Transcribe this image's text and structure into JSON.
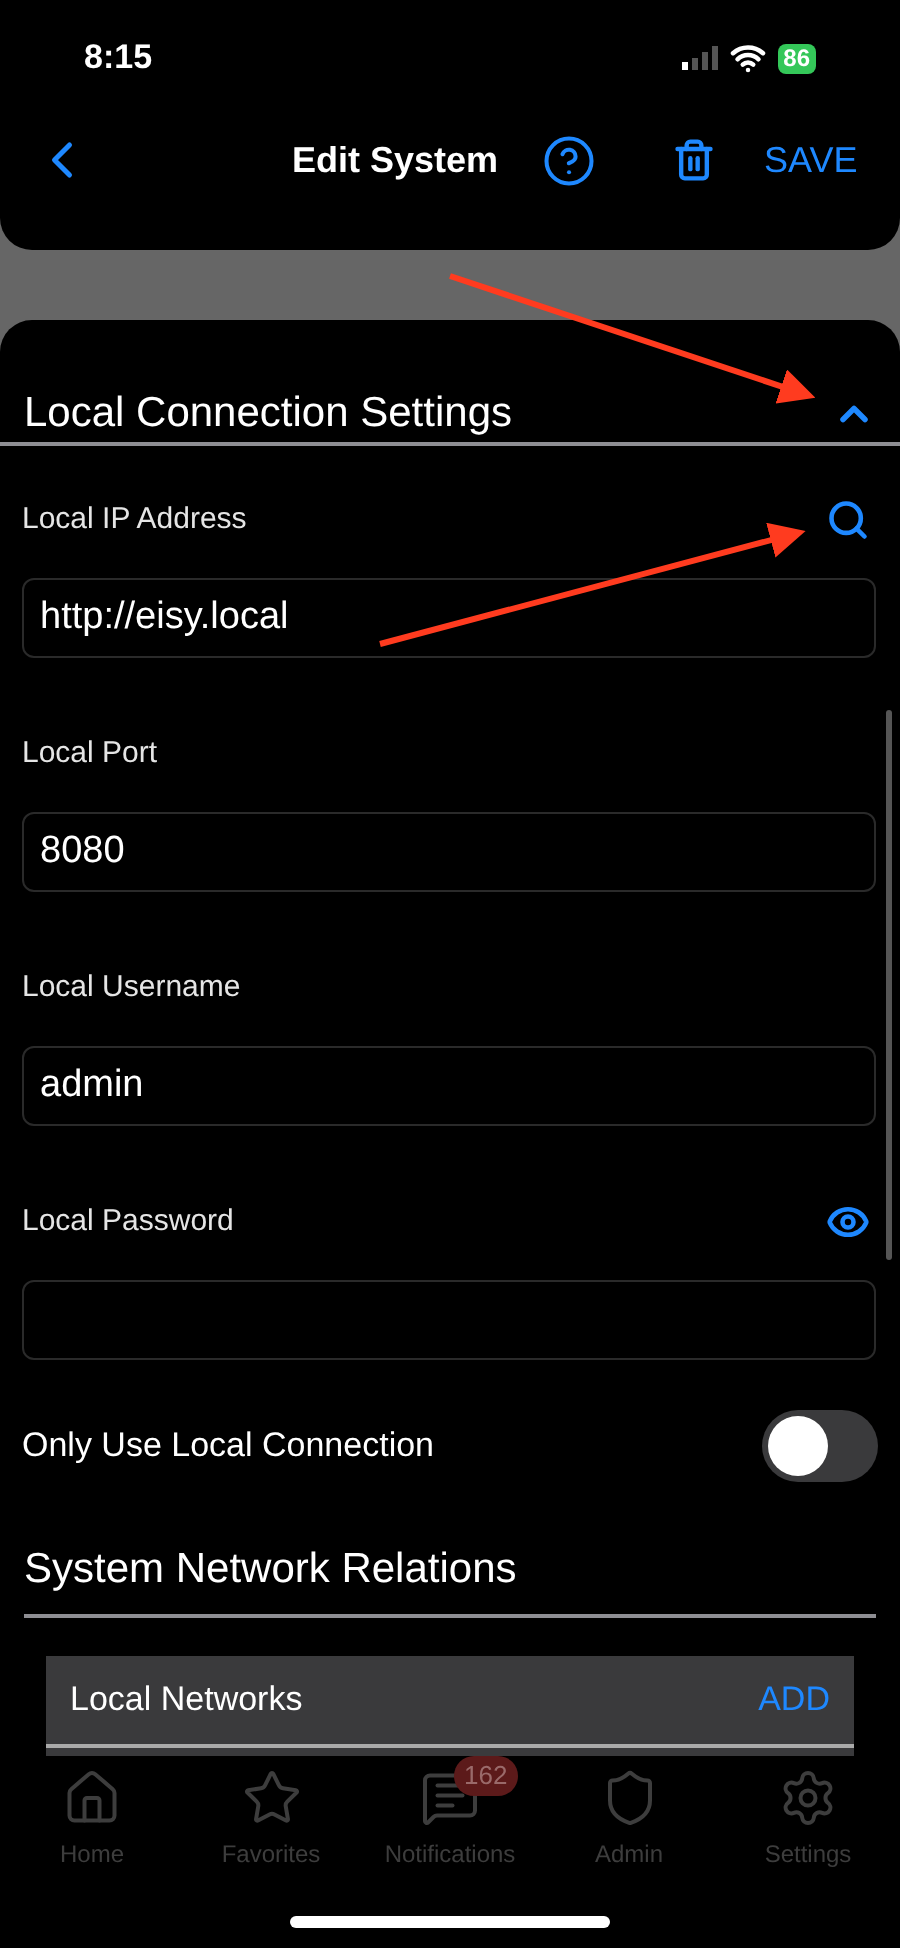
{
  "status_bar": {
    "time": "8:15",
    "battery": "86"
  },
  "header": {
    "title": "Edit System",
    "save": "SAVE"
  },
  "section": {
    "title": "Local Connection Settings",
    "expanded": true
  },
  "fields": [
    {
      "label": "Local IP Address",
      "value": "http://eisy.local"
    },
    {
      "label": "Local Port",
      "value": "8080"
    },
    {
      "label": "Local Username",
      "value": "admin"
    },
    {
      "label": "Local Password"
    }
  ],
  "local_only": {
    "label": "Only Use Local Connection",
    "on": false
  },
  "relations": {
    "title": "System Network Relations",
    "list_title": "Local Networks",
    "add": "ADD"
  },
  "tab_bar": [
    {
      "label": "Home"
    },
    {
      "label": "Favorites"
    },
    {
      "label": "Notifications",
      "badge": "162"
    },
    {
      "label": "Admin"
    },
    {
      "label": "Settings"
    }
  ],
  "annotations": [
    {
      "kind": "arrow"
    },
    {
      "kind": "arrow"
    }
  ]
}
